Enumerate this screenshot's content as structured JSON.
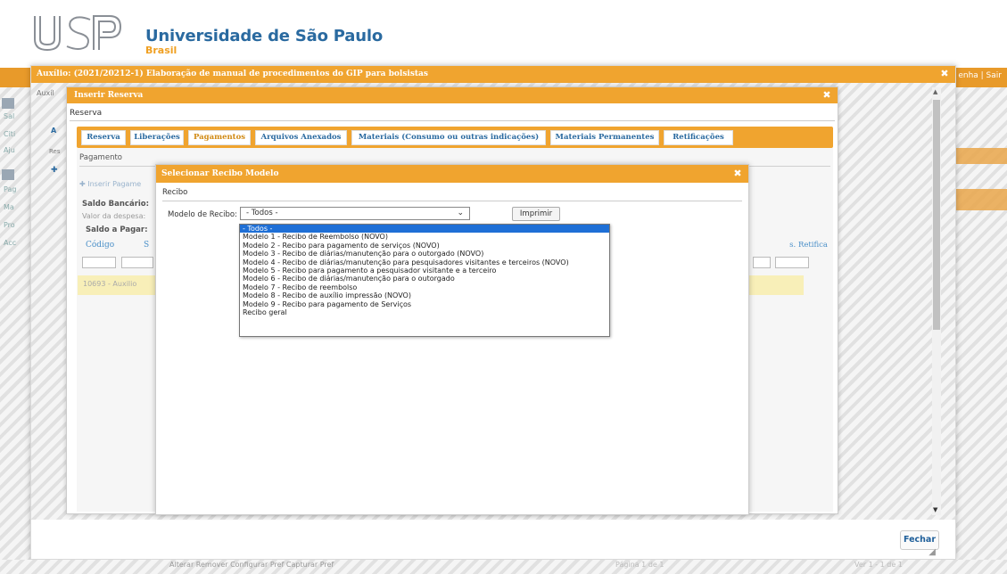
{
  "header": {
    "university_name": "Universidade de São Paulo",
    "country": "Brasil",
    "top_links": "enha | Sair"
  },
  "background": {
    "left_strip": [
      "Au",
      "Sal",
      "Citi",
      "Aju",
      "Au",
      "Pag",
      "Ma",
      "Pro",
      "Acc"
    ]
  },
  "outer_dialog": {
    "title": "Auxílio: (2021/20212-1) Elaboração de manual de procedimentos do GIP para bolsistas",
    "close_icon": "close-icon",
    "fechar_label": "Fechar",
    "sidebar_labels": [
      "Auxíl",
      "A",
      "Res"
    ]
  },
  "reserva_dialog": {
    "title": "Inserir Reserva",
    "section_label": "Reserva",
    "tabs": [
      {
        "label": "Reserva"
      },
      {
        "label": "Liberações"
      },
      {
        "label": "Pagamentos"
      },
      {
        "label": "Arquivos Anexados"
      },
      {
        "label": "Materiais (Consumo ou outras indicações)"
      },
      {
        "label": "Materiais Permanentes"
      },
      {
        "label": "Retificações"
      }
    ],
    "active_tab": "Pagamentos",
    "pagamento": {
      "label": "Pagamento",
      "inserir_label": "Inserir Pagame",
      "saldo_bancario": "Saldo Bancário:",
      "valor_despesa": "Valor da despesa:",
      "saldo_pagar": "Saldo a Pagar:",
      "col_codigo": "Código",
      "col_s": "S",
      "col_retifica": "s. Retifica",
      "row_text": "10693 - Auxilio"
    }
  },
  "recibo_dialog": {
    "title": "Selecionar Recibo Modelo",
    "section_label": "Recibo",
    "modelo_label": "Modelo de Recibo:",
    "selected_value": "- Todos -",
    "imprimir_label": "Imprimir",
    "options": [
      "- Todos -",
      "Modelo 1 - Recibo de Reembolso (NOVO)",
      "Modelo 2 - Recibo para pagamento de serviços (NOVO)",
      "Modelo 3 - Recibo de diárias/manutenção para o outorgado (NOVO)",
      "Modelo 4 - Recibo de diárias/manutenção para pesquisadores visitantes e terceiros (NOVO)",
      "Modelo 5 - Recibo para pagamento a pesquisador visitante e a terceiro",
      "Modelo 6 - Recibo de diárias/manutenção para o outorgado",
      "Modelo 7 - Recibo de reembolso",
      "Modelo 8 - Recibo de auxílio impressão (NOVO)",
      "Modelo 9 - Recibo para pagamento de Serviços",
      "Recibo geral"
    ]
  },
  "bottom_bar": {
    "actions": "Alterar   Remover   Configurar Pref   Capturar Pref",
    "pager": "Página 1   de 1",
    "count": "Ver 1 - 1 de 1"
  },
  "colors": {
    "accent_orange": "#f0a42f",
    "link_blue": "#2a6aa0",
    "selected_blue": "#1e6fd6"
  }
}
